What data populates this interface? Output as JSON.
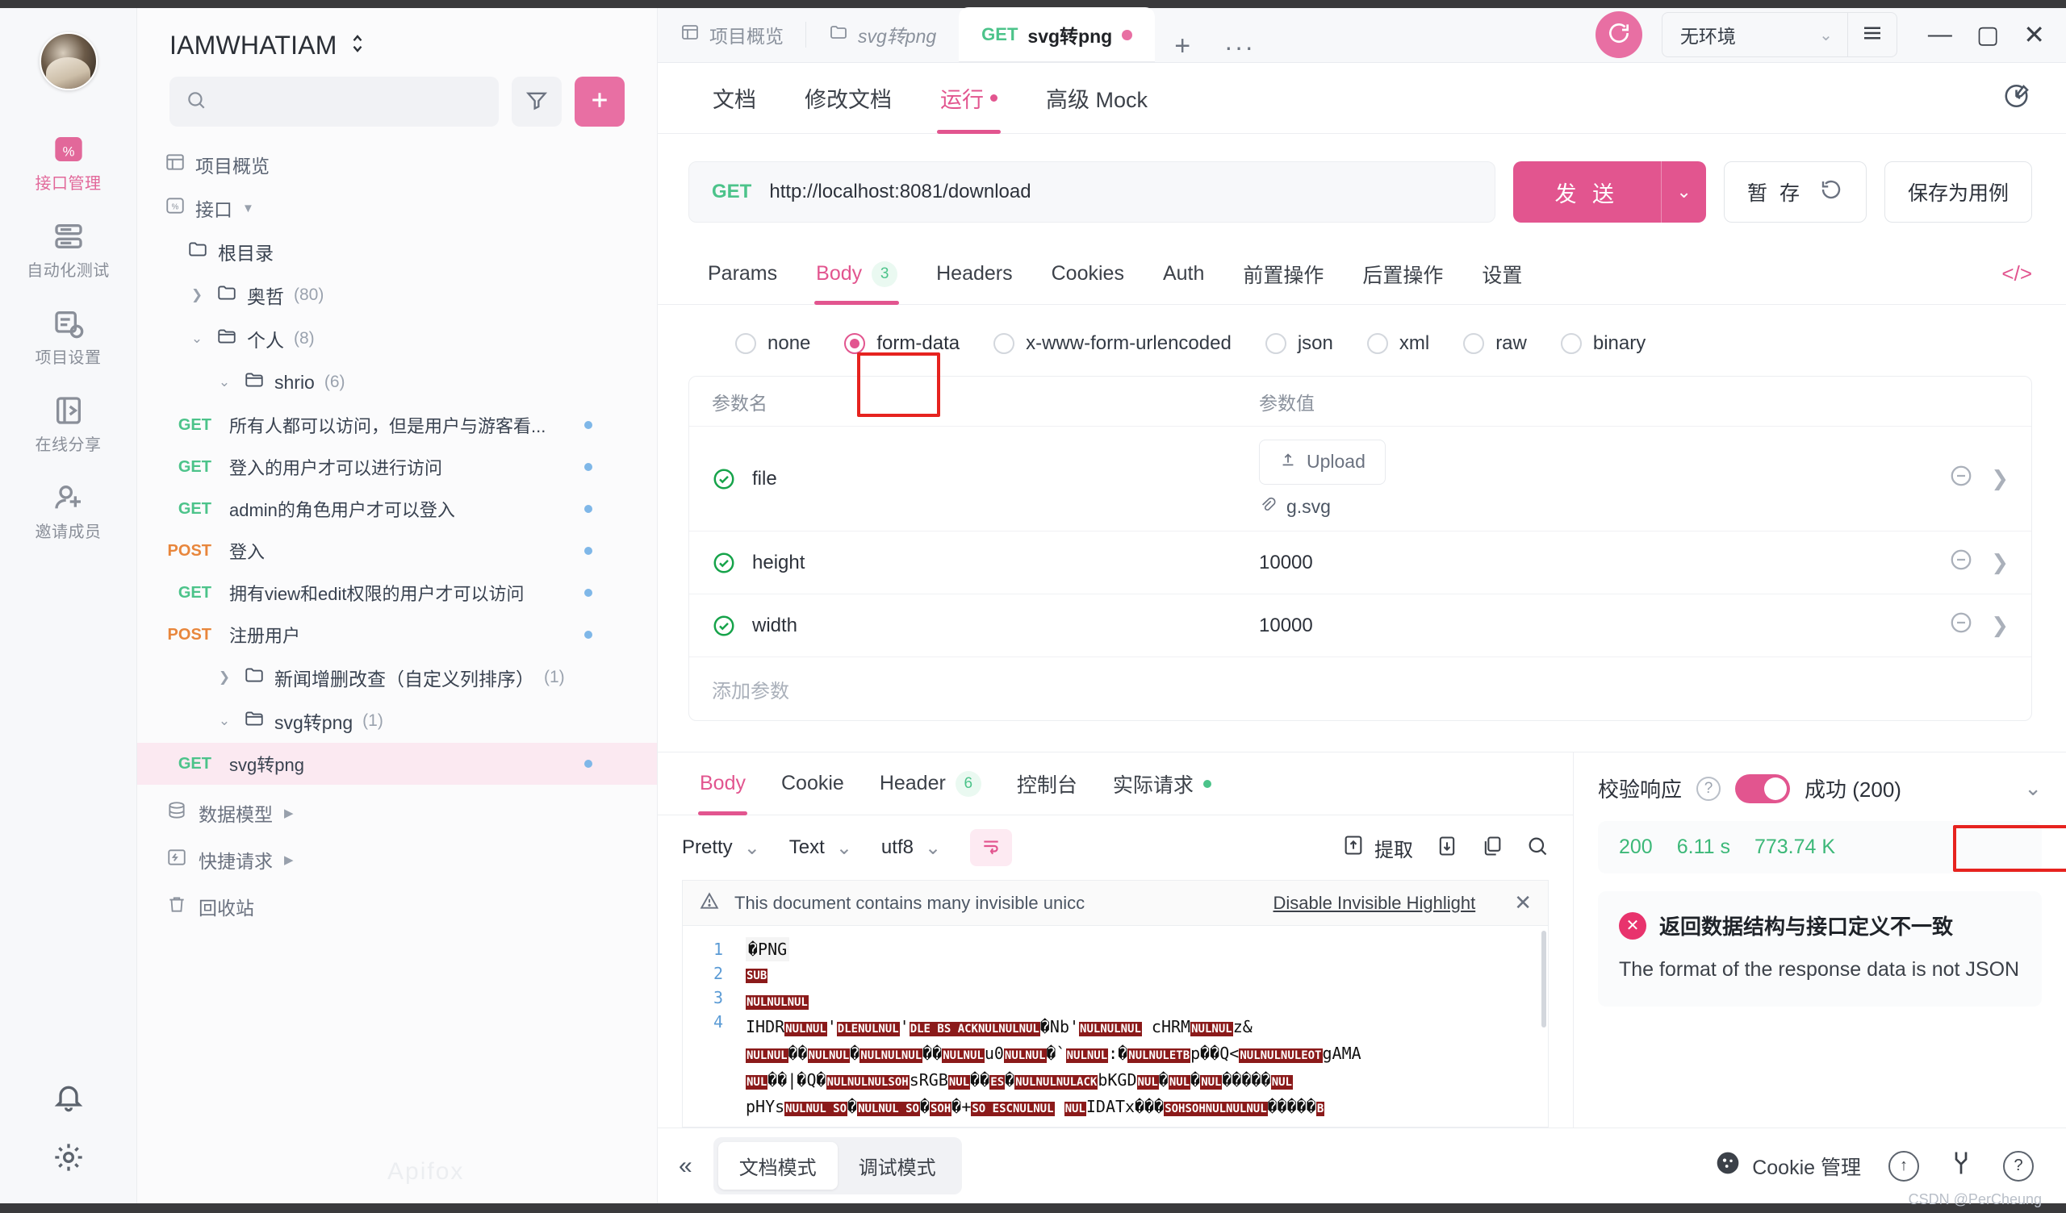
{
  "rail": {
    "items": [
      {
        "label": "接口管理",
        "icon": "api-icon",
        "active": true
      },
      {
        "label": "自动化测试",
        "icon": "automation-icon",
        "active": false
      },
      {
        "label": "项目设置",
        "icon": "project-settings-icon",
        "active": false
      },
      {
        "label": "在线分享",
        "icon": "share-icon",
        "active": false
      },
      {
        "label": "邀请成员",
        "icon": "invite-member-icon",
        "active": false
      }
    ],
    "bottom": [
      {
        "name": "notification-bell-icon"
      },
      {
        "name": "settings-gear-icon"
      }
    ]
  },
  "sidebar": {
    "project_name": "IAMWHATIAM",
    "search_placeholder": "",
    "filter_icon": "filter-icon",
    "add_icon": "plus-icon",
    "overview_label": "项目概览",
    "interface_label": "接口",
    "tree": [
      {
        "type": "folder",
        "label": "根目录",
        "count": "",
        "indent": 1,
        "caret": ""
      },
      {
        "type": "folder",
        "label": "奥哲",
        "count": "(80)",
        "indent": 1,
        "caret": "collapsed"
      },
      {
        "type": "folder",
        "label": "个人",
        "count": "(8)",
        "indent": 1,
        "caret": "expanded"
      },
      {
        "type": "folder",
        "label": "shrio",
        "count": "(6)",
        "indent": 2,
        "caret": "expanded"
      },
      {
        "type": "api",
        "method": "GET",
        "label": "所有人都可以访问，但是用户与游客看...",
        "indent": 3
      },
      {
        "type": "api",
        "method": "GET",
        "label": "登入的用户才可以进行访问",
        "indent": 3
      },
      {
        "type": "api",
        "method": "GET",
        "label": "admin的角色用户才可以登入",
        "indent": 3
      },
      {
        "type": "api",
        "method": "POST",
        "label": "登入",
        "indent": 3
      },
      {
        "type": "api",
        "method": "GET",
        "label": "拥有view和edit权限的用户才可以访问",
        "indent": 3
      },
      {
        "type": "api",
        "method": "POST",
        "label": "注册用户",
        "indent": 3
      },
      {
        "type": "folder",
        "label": "新闻增删改查（自定义列排序）",
        "count": "(1)",
        "indent": 2,
        "caret": "collapsed"
      },
      {
        "type": "folder",
        "label": "svg转png",
        "count": "(1)",
        "indent": 2,
        "caret": "expanded"
      },
      {
        "type": "api",
        "method": "GET",
        "label": "svg转png",
        "indent": 3,
        "selected": true
      }
    ],
    "footer": [
      {
        "label": "数据模型",
        "icon": "data-model-icon"
      },
      {
        "label": "快捷请求",
        "icon": "quick-request-icon"
      },
      {
        "label": "回收站",
        "icon": "trash-icon"
      }
    ]
  },
  "tabs": [
    {
      "label": "项目概览",
      "icon": "overview-icon",
      "active": false,
      "italic": false,
      "method": ""
    },
    {
      "label": "svg转png",
      "icon": "folder-icon",
      "active": false,
      "italic": true,
      "method": ""
    },
    {
      "label": "svg转png",
      "icon": "",
      "active": true,
      "italic": false,
      "method": "GET",
      "dirty": true
    }
  ],
  "tabbar": {
    "add_label": "+",
    "more_label": "···",
    "sync_icon": "sync-icon",
    "environment": "无环境",
    "menu_icon": "hamburger-icon",
    "minimize": "—",
    "maximize": "▢",
    "close": "✕"
  },
  "subtabs": [
    {
      "label": "文档",
      "active": false
    },
    {
      "label": "修改文档",
      "active": false
    },
    {
      "label": "运行",
      "active": true,
      "dot": true
    },
    {
      "label": "高级 Mock",
      "active": false
    }
  ],
  "subtabs_right_icon": "edit-history-icon",
  "request": {
    "method": "GET",
    "url": "http://localhost:8081/download",
    "send_label": "发 送",
    "save_label": "暂 存",
    "reset_icon": "reset-icon",
    "save_as_example_label": "保存为用例"
  },
  "param_tabs": [
    {
      "label": "Params",
      "active": false,
      "count": ""
    },
    {
      "label": "Body",
      "active": true,
      "count": "3"
    },
    {
      "label": "Headers",
      "active": false,
      "count": ""
    },
    {
      "label": "Cookies",
      "active": false,
      "count": ""
    },
    {
      "label": "Auth",
      "active": false,
      "count": ""
    },
    {
      "label": "前置操作",
      "active": false,
      "count": ""
    },
    {
      "label": "后置操作",
      "active": false,
      "count": ""
    },
    {
      "label": "设置",
      "active": false,
      "count": ""
    }
  ],
  "code_icon": "</>",
  "body_types": [
    {
      "label": "none",
      "selected": false
    },
    {
      "label": "form-data",
      "selected": true
    },
    {
      "label": "x-www-form-urlencoded",
      "selected": false
    },
    {
      "label": "json",
      "selected": false
    },
    {
      "label": "xml",
      "selected": false
    },
    {
      "label": "raw",
      "selected": false
    },
    {
      "label": "binary",
      "selected": false
    }
  ],
  "param_table": {
    "header": {
      "name": "参数名",
      "value": "参数值"
    },
    "rows": [
      {
        "name": "file",
        "value": "",
        "upload_label": "Upload",
        "file_name": "g.svg",
        "kind": "file"
      },
      {
        "name": "height",
        "value": "10000",
        "kind": "text",
        "highlighted": true
      },
      {
        "name": "width",
        "value": "10000",
        "kind": "text",
        "highlighted": true
      }
    ],
    "add_label": "添加参数"
  },
  "response": {
    "tabs": [
      {
        "label": "Body",
        "active": true,
        "count": ""
      },
      {
        "label": "Cookie",
        "active": false,
        "count": ""
      },
      {
        "label": "Header",
        "active": false,
        "count": "6"
      },
      {
        "label": "控制台",
        "active": false,
        "count": ""
      },
      {
        "label": "实际请求",
        "active": false,
        "count": "",
        "dot": true
      }
    ],
    "toolbar": {
      "pretty": "Pretty",
      "text": "Text",
      "charset": "utf8",
      "wrap_icon": "wrap-text-icon",
      "extract_label": "提取",
      "download_icon": "download-icon",
      "copy_icon": "copy-icon",
      "search_icon": "search-icon"
    },
    "warning": {
      "text": "This document contains many invisible unicc",
      "action": "Disable Invisible Highlight",
      "close": "✕"
    },
    "lines": [
      {
        "n": "1",
        "text": "\u0000PNG"
      },
      {
        "n": "2",
        "text": "SUB"
      },
      {
        "n": "3",
        "text": "NULNULNUL"
      },
      {
        "n": "4",
        "text": "IHDR"
      }
    ]
  },
  "validation": {
    "title": "校验响应",
    "status_label": "成功 (200)",
    "status_code": "200",
    "time": "6.11 s",
    "size": "773.74 K",
    "error_title": "返回数据结构与接口定义不一致",
    "error_text": "The format of the response data is not JSON"
  },
  "bottom": {
    "collapse_icon": "«",
    "modes": [
      {
        "label": "文档模式",
        "active": true
      },
      {
        "label": "调试模式",
        "active": false
      }
    ],
    "cookie_label": "Cookie 管理",
    "upload_icon": "upload-circle-icon",
    "tools_icon": "tools-icon",
    "help_icon": "help-icon",
    "watermark": "CSDN @PerCheung",
    "brand": "Apifox"
  }
}
